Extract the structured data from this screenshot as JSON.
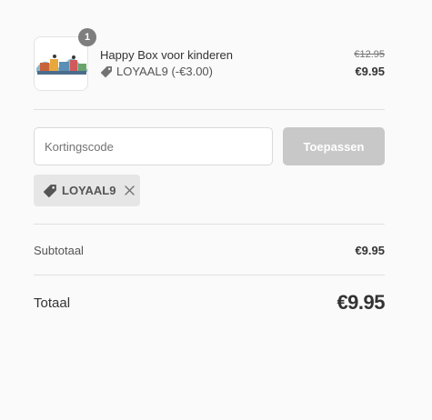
{
  "order": {
    "item": {
      "quantity": "1",
      "name": "Happy Box voor kinderen",
      "discount_text": "LOYAAL9 (-€3.00)",
      "original_price": "€12.95",
      "price": "€9.95",
      "image_icon": "product-image-icon"
    }
  },
  "discount": {
    "input_placeholder": "Kortingscode",
    "input_value": "",
    "apply_label": "Toepassen",
    "applied_code": "LOYAAL9",
    "tag_icon": "tag-icon",
    "remove_icon": "close-icon"
  },
  "totals": {
    "subtotal_label": "Subtotaal",
    "subtotal_value": "€9.95",
    "total_label": "Totaal",
    "total_value": "€9.95"
  },
  "colors": {
    "background": "#fafafa",
    "badge": "#7e7e7e",
    "button_disabled": "#c8c8c8",
    "applied_tag_bg": "#e6e6e6",
    "text": "#333333"
  }
}
